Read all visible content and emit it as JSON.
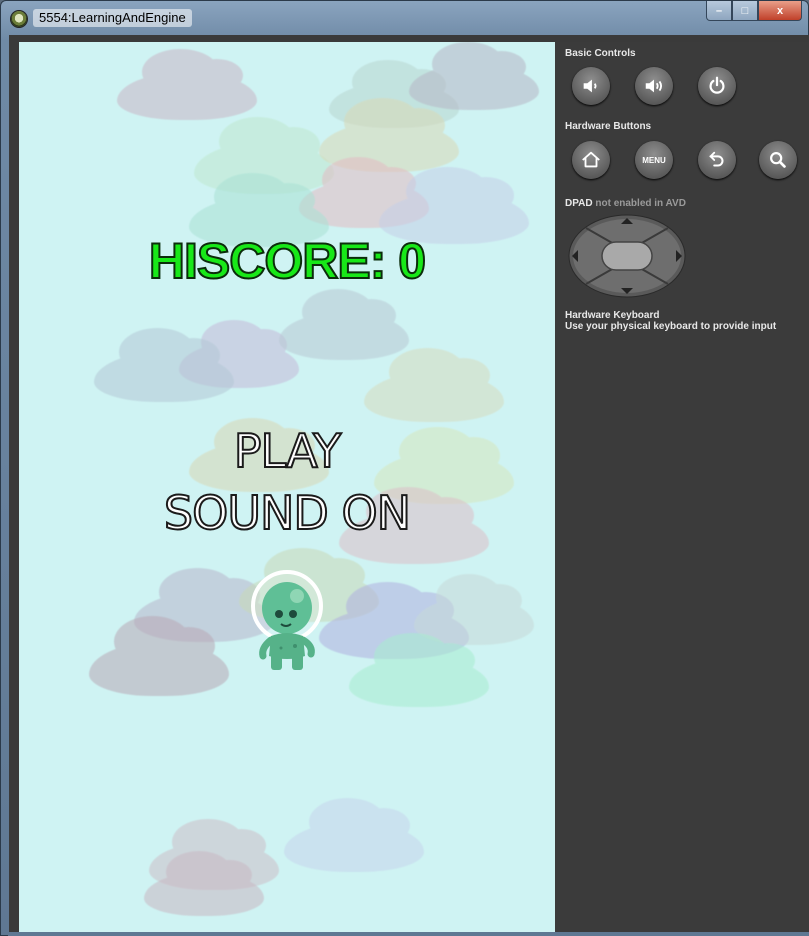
{
  "window": {
    "title": "5554:LearningAndEngine",
    "minimize_label": "–",
    "maximize_label": "□",
    "close_label": "x"
  },
  "game": {
    "hiscore_text": "HISCORE: 0",
    "menu": {
      "play_label": "PLAY",
      "sound_label": "SOUND ON"
    },
    "colors": {
      "background": "#cff3f3",
      "hiscore": "#18e818",
      "menu_text": "#ffffff",
      "alien": "#5fbf96"
    }
  },
  "controls": {
    "basic_controls_label": "Basic Controls",
    "basic_buttons": [
      {
        "icon": "volume-down-icon"
      },
      {
        "icon": "volume-up-icon"
      },
      {
        "icon": "power-icon"
      }
    ],
    "hardware_buttons_label": "Hardware Buttons",
    "hardware_buttons": [
      {
        "icon": "home-icon"
      },
      {
        "icon": "menu-icon",
        "label": "MENU"
      },
      {
        "icon": "back-icon"
      },
      {
        "icon": "search-icon"
      }
    ],
    "dpad_label_bold": "DPAD",
    "dpad_label_rest": "not enabled in AVD",
    "keyboard_title": "Hardware Keyboard",
    "keyboard_text": "Use your physical keyboard to provide input"
  }
}
